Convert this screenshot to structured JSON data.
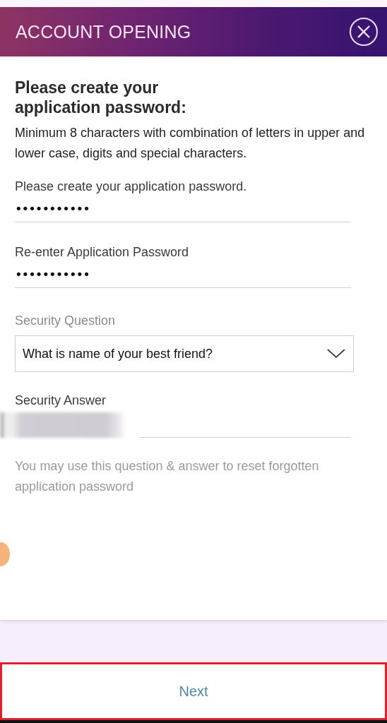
{
  "header": {
    "title": "ACCOUNT OPENING"
  },
  "heading": "Please create your application password:",
  "instructions": "Minimum 8 characters with combination of letters in upper and lower case, digits and special characters.",
  "fields": [
    {
      "kind": "password",
      "label": "Please create your application password.",
      "value": "•••••••••••"
    },
    {
      "kind": "password",
      "label": "Re-enter Application Password",
      "value": "•••••••••••"
    },
    {
      "kind": "select",
      "label": "Security Question",
      "value": "What is name of your best friend?"
    },
    {
      "kind": "redacted",
      "label": "Security Answer"
    }
  ],
  "hint": "You may use this question & answer to reset forgotten application password",
  "next_button": {
    "label": "Next"
  }
}
